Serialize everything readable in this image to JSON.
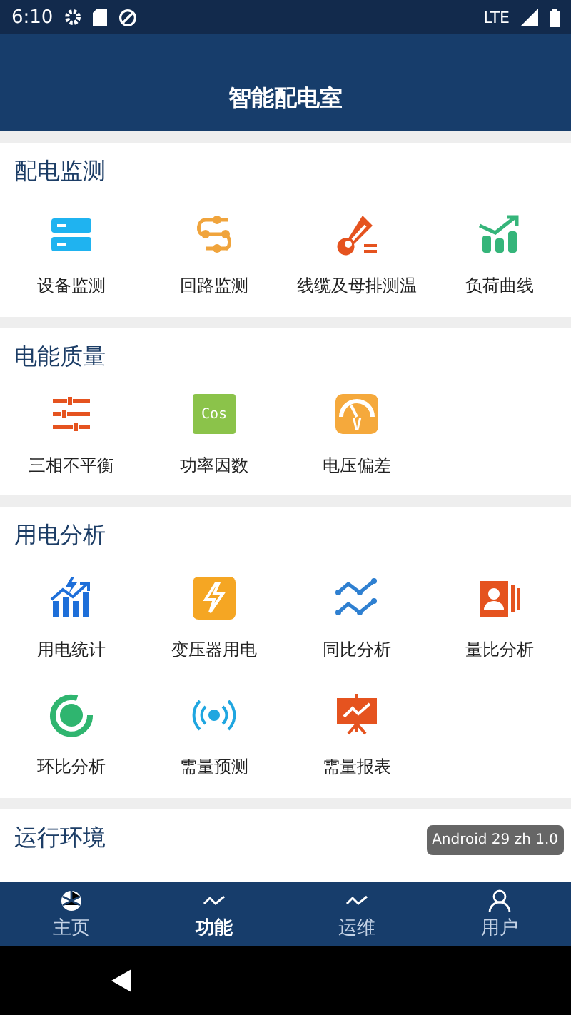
{
  "status_bar": {
    "time": "6:10",
    "network": "LTE"
  },
  "header": {
    "title": "智能配电室"
  },
  "sections": [
    {
      "title": "配电监测",
      "items": [
        {
          "label": "设备监测"
        },
        {
          "label": "回路监测"
        },
        {
          "label": "线缆及母排测温"
        },
        {
          "label": "负荷曲线"
        }
      ]
    },
    {
      "title": "电能质量",
      "items": [
        {
          "label": "三相不平衡"
        },
        {
          "label": "功率因数",
          "icon_text": "Cos"
        },
        {
          "label": "电压偏差",
          "icon_text": "V"
        }
      ]
    },
    {
      "title": "用电分析",
      "items": [
        {
          "label": "用电统计"
        },
        {
          "label": "变压器用电"
        },
        {
          "label": "同比分析"
        },
        {
          "label": "量比分析"
        },
        {
          "label": "环比分析"
        },
        {
          "label": "需量预测"
        },
        {
          "label": "需量报表"
        }
      ]
    },
    {
      "title": "运行环境"
    }
  ],
  "toast": "Android 29 zh 1.0",
  "bottom_nav": [
    {
      "label": "主页",
      "selected": false
    },
    {
      "label": "功能",
      "selected": true
    },
    {
      "label": "运维",
      "selected": false
    },
    {
      "label": "用户",
      "selected": false
    }
  ]
}
